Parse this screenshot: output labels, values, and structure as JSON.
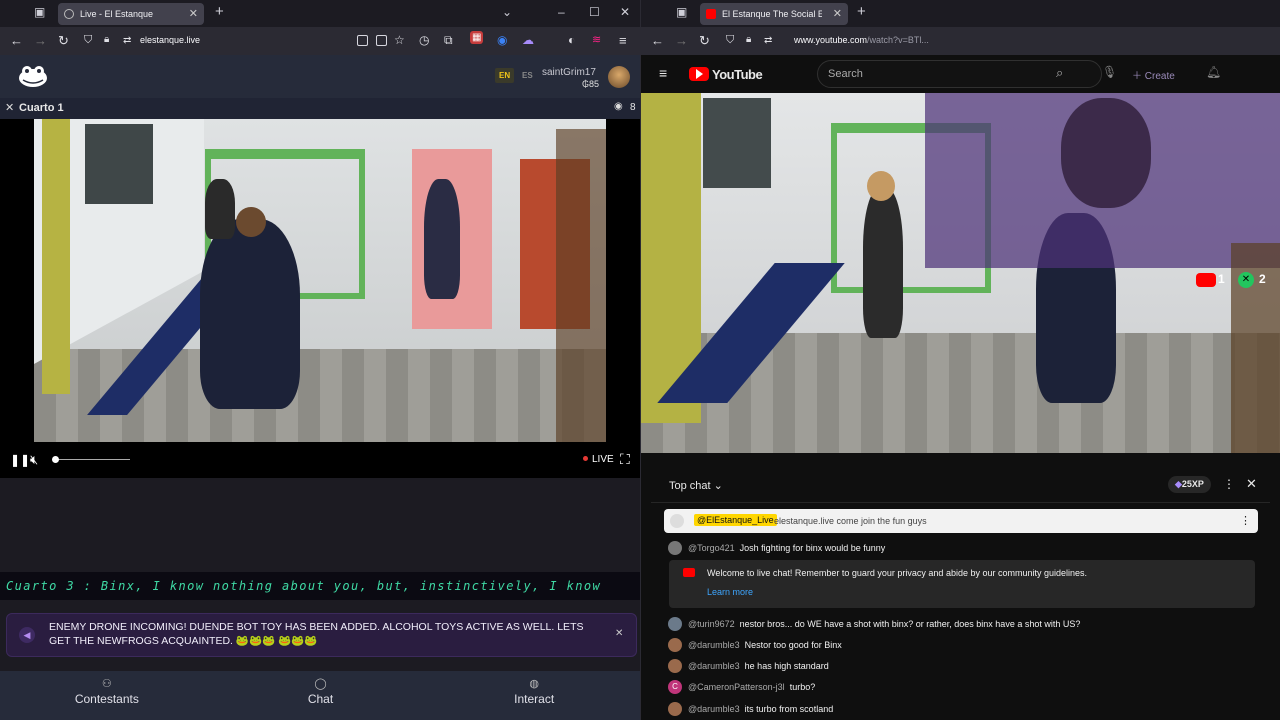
{
  "left": {
    "tab": {
      "title": "Live - El Estanque"
    },
    "url": "elestanque.live",
    "site": {
      "lang_en": "EN",
      "lang_es": "ES",
      "username": "saintGrim17",
      "balance": "₲85"
    },
    "room": {
      "title": "Cuarto 1",
      "viewers": "8"
    },
    "player": {
      "live_label": "LIVE",
      "volume": 0.0
    },
    "ticker": "Cuarto 3 : Binx, I know nothing about you, but, instinctively, I know",
    "notice": {
      "text": "ENEMY DRONE INCOMING! DUENDE BOT TOY HAS BEEN ADDED. ALCOHOL TOYS ACTIVE AS WELL. LETS GET THE NEWFROGS ACQUAINTED. 🐸🐸🐸 🐸🐸🐸"
    },
    "nav": {
      "contestants": "Contestants",
      "chat": "Chat",
      "interact": "Interact"
    }
  },
  "right": {
    "tab": {
      "title": "El Estanque The Social Exp"
    },
    "url_prefix": "www.youtube.com",
    "url_rest": "/watch?v=BTl...",
    "yt": {
      "logo": "YouTube",
      "search_placeholder": "Search",
      "create": "Create"
    },
    "overlay": {
      "yt_count": "1",
      "green_count": "2"
    },
    "chat": {
      "header": "Top chat",
      "xp": "25XP",
      "pinned_author": "@ElEstanque_Live",
      "pinned_text": "elestanque.live come join the fun guys",
      "welcome_text": "Welcome to live chat! Remember to guard your privacy and abide by our community guidelines.",
      "learn_more": "Learn more",
      "messages": [
        {
          "author": "@Torgo421",
          "text": "Josh fighting for binx would be funny",
          "color": "#777777"
        },
        {
          "author": "@turin9672",
          "text": "nestor bros... do WE have a shot with binx? or rather, does binx have a shot with US?",
          "color": "#6b7a8a"
        },
        {
          "author": "@darumble3",
          "text": "Nestor too good for Binx",
          "color": "#9a6a4c"
        },
        {
          "author": "@darumble3",
          "text": "he has high standard",
          "color": "#9a6a4c"
        },
        {
          "author": "@CameronPatterson-j3l",
          "text": "turbo?",
          "color": "#c0357a"
        },
        {
          "author": "@darumble3",
          "text": "its turbo from scotland",
          "color": "#9a6a4c"
        }
      ]
    }
  },
  "colors": {
    "accent_purple": "#7b3ff2",
    "ticker_green": "#3fd9a4",
    "yt_red": "#ff0000"
  }
}
